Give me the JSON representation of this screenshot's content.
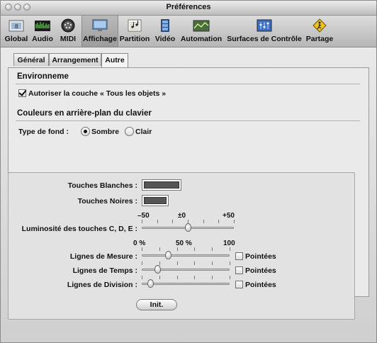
{
  "window": {
    "title": "Préférences"
  },
  "toolbar": {
    "items": [
      {
        "label": "Global",
        "icon": "global-icon"
      },
      {
        "label": "Audio",
        "icon": "audio-icon"
      },
      {
        "label": "MIDI",
        "icon": "midi-icon"
      },
      {
        "label": "Affichage",
        "icon": "display-icon",
        "selected": true
      },
      {
        "label": "Partition",
        "icon": "score-icon"
      },
      {
        "label": "Vidéo",
        "icon": "video-icon"
      },
      {
        "label": "Automation",
        "icon": "automation-icon"
      },
      {
        "label": "Surfaces de Contrôle",
        "icon": "control-surfaces-icon"
      },
      {
        "label": "Partage",
        "icon": "sharing-icon"
      }
    ]
  },
  "tabs": [
    {
      "label": "Général"
    },
    {
      "label": "Arrangement"
    },
    {
      "label": "Autre",
      "active": true
    }
  ],
  "environment": {
    "title": "Environneme",
    "show_all_objects_label": "Autoriser la couche « Tous les objets »",
    "show_all_objects_checked": true
  },
  "keyboard_bg": {
    "title": "Couleurs en arrière-plan du clavier",
    "type_label": "Type de fond :",
    "options": [
      {
        "label": "Sombre",
        "selected": true
      },
      {
        "label": "Clair",
        "selected": false
      }
    ],
    "white_keys_label": "Touches Blanches :",
    "black_keys_label": "Touches Noires :",
    "brightness_label": "Luminosité des touches C, D, E :",
    "brightness_scale": [
      "–50",
      "±0",
      "+50"
    ],
    "brightness_value": 0,
    "lines_scale": [
      "0 %",
      "50 %",
      "100"
    ],
    "measure_label": "Lignes de Mesure :",
    "measure_value": 30,
    "beat_label": "Lignes de Temps :",
    "beat_value": 18,
    "division_label": "Lignes de Division :",
    "division_value": 10,
    "dotted_label": "Pointées",
    "reset_label": "Init."
  },
  "colors": {
    "key_swatch": "#555555",
    "selected_tab_bg": "#f4f4f4"
  }
}
